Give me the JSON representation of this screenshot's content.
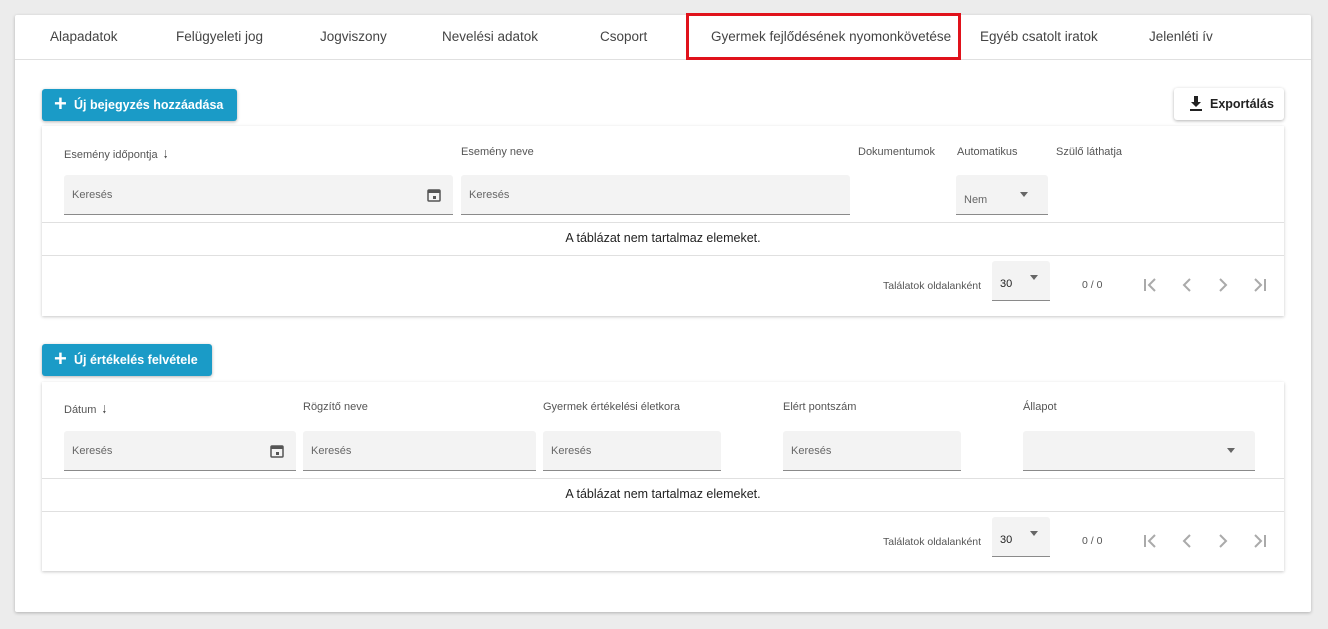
{
  "tabs": [
    {
      "label": "Alapadatok"
    },
    {
      "label": "Felügyeleti jog"
    },
    {
      "label": "Jogviszony"
    },
    {
      "label": "Nevelési adatok"
    },
    {
      "label": "Csoport"
    },
    {
      "label": "Gyermek fejlődésének nyomonkövetése"
    },
    {
      "label": "Egyéb csatolt iratok"
    },
    {
      "label": "Jelenléti ív"
    }
  ],
  "active_tab": "Gyermek fejlődésének nyomonkövetése",
  "highlight_color": "#e0121b",
  "accent_color": "#1a9bc7",
  "entries": {
    "add_button": "Új bejegyzés hozzáadása",
    "export_button": "Exportálás",
    "columns": [
      "Esemény időpontja",
      "Esemény neve",
      "Dokumentumok",
      "Automatikus",
      "Szülő láthatja"
    ],
    "filters": {
      "date_placeholder": "Keresés",
      "name_placeholder": "Keresés",
      "automatic_value": "Nem"
    },
    "empty_message": "A táblázat nem tartalmaz elemeket.",
    "pager": {
      "label": "Találatok oldalanként",
      "page_size": "30",
      "count": "0 / 0"
    }
  },
  "evaluations": {
    "add_button": "Új értékelés felvétele",
    "columns": [
      "Dátum",
      "Rögzítő neve",
      "Gyermek értékelési életkora",
      "Elért pontszám",
      "Állapot"
    ],
    "filters": {
      "date_placeholder": "Keresés",
      "recorder_placeholder": "Keresés",
      "age_placeholder": "Keresés",
      "score_placeholder": "Keresés",
      "status_value": ""
    },
    "empty_message": "A táblázat nem tartalmaz elemeket.",
    "pager": {
      "label": "Találatok oldalanként",
      "page_size": "30",
      "count": "0 / 0"
    }
  },
  "icons": {
    "plus": "plus-icon",
    "download": "download-icon",
    "calendar": "calendar-icon",
    "sort": "arrow-down-icon",
    "first": "first-page-icon",
    "prev": "chevron-left-icon",
    "next": "chevron-right-icon",
    "last": "last-page-icon"
  }
}
